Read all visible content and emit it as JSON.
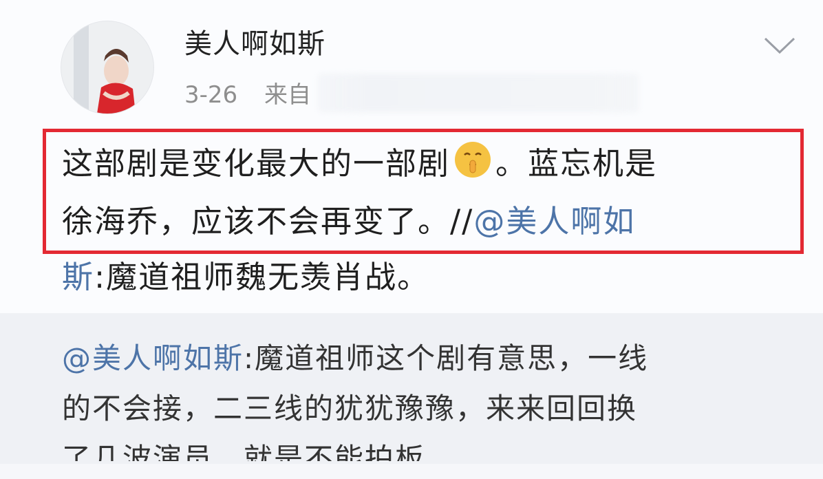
{
  "post": {
    "username": "美人啊如斯",
    "time": "3-26",
    "source_prefix": "来自",
    "text_line1_a": "这部剧是变化最大的一部剧",
    "text_line1_b": "。蓝忘机是",
    "text_line2_a": "徐海乔，应该不会再变了。//",
    "text_line2_mention": "@美人啊如",
    "text_line3_mention": "斯",
    "text_line3_b": ":魔道祖师魏无羡肖战。",
    "emoji": "shush-face-emoji"
  },
  "repost": {
    "mention": "@美人啊如斯",
    "line1_b": ":魔道祖师这个剧有意思，一线",
    "line2": "的不会接，二三线的犹犹豫豫，来来回回换",
    "line3": "了几波演员，就是不能拍板"
  },
  "colors": {
    "highlight_border": "#e32933",
    "mention": "#4d74a8"
  }
}
